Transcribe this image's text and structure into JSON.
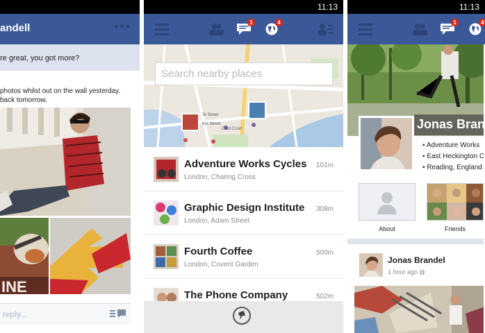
{
  "screen1": {
    "status_time": "",
    "title": "andell",
    "more_dots": "•••",
    "message_top": "re great, you got more?",
    "message_body_line1": "photos whilst out on the wall yesterday.",
    "message_body_line2": "back tomorrow.",
    "reply_placeholder": "reply...",
    "icons": [
      "more-dots-icon",
      "send-icon"
    ]
  },
  "screen2": {
    "status_time": "11:13",
    "search_placeholder": "Search nearby places",
    "map_labels": [
      "St Street",
      "Cecil Court",
      "Kin Street"
    ],
    "places": [
      {
        "name": "Adventure Works Cycles",
        "sub": "London, Charing Cross",
        "dist": "101m"
      },
      {
        "name": "Graphic Design Institute",
        "sub": "London, Adam Street",
        "dist": "308m"
      },
      {
        "name": "Fourth Coffee",
        "sub": "London, Covent Garden",
        "dist": "500m"
      },
      {
        "name": "The Phone Company",
        "sub": "",
        "dist": "502m"
      }
    ],
    "badges": {
      "messages": "1",
      "notifications": "4"
    },
    "icons": [
      "menu-icon",
      "friends-icon",
      "messages-icon",
      "globe-icon",
      "friend-requests-icon",
      "pin-icon"
    ]
  },
  "screen3": {
    "status_time": "11:13",
    "profile_name": "Jonas Brandel",
    "info": [
      "Adventure Works",
      "East Heckington C",
      "Reading, England"
    ],
    "tiles": [
      {
        "label": "About"
      },
      {
        "label": "Friends"
      }
    ],
    "post_name": "Jonas Brandel",
    "post_time": "1 hour ago",
    "badges": {
      "messages": "1",
      "notifications": "4"
    },
    "icons": [
      "menu-icon",
      "friends-icon",
      "messages-icon",
      "globe-icon"
    ]
  },
  "colors": {
    "brand": "#3b5998",
    "icon_dark": "#2c4478",
    "badge": "#d9261c"
  }
}
